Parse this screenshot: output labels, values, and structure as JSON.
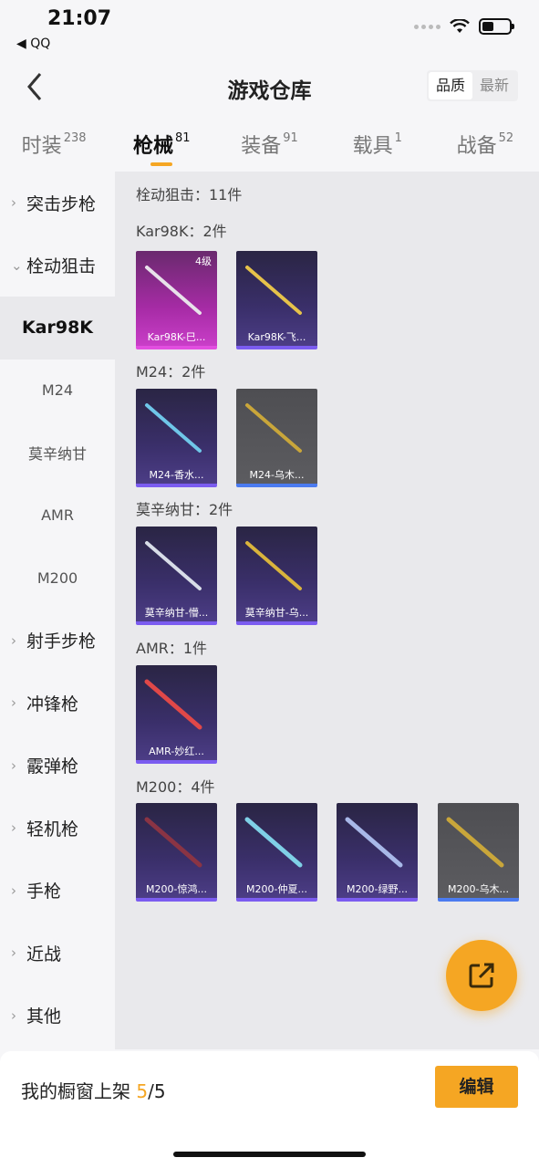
{
  "status": {
    "time": "21:07",
    "back_app": "◀ QQ"
  },
  "header": {
    "title": "游戏仓库",
    "sort_options": [
      "品质",
      "最新"
    ],
    "sort_active": "品质"
  },
  "tabs": [
    {
      "label": "时装",
      "count": "238"
    },
    {
      "label": "枪械",
      "count": "81"
    },
    {
      "label": "装备",
      "count": "91"
    },
    {
      "label": "载具",
      "count": "1"
    },
    {
      "label": "战备",
      "count": "52"
    }
  ],
  "sidebar": [
    {
      "label": "突击步枪",
      "kind": "cat"
    },
    {
      "label": "栓动狙击",
      "kind": "cat-open"
    },
    {
      "label": "Kar98K",
      "kind": "sub-active"
    },
    {
      "label": "M24",
      "kind": "sub"
    },
    {
      "label": "莫辛纳甘",
      "kind": "sub"
    },
    {
      "label": "AMR",
      "kind": "sub"
    },
    {
      "label": "M200",
      "kind": "sub"
    },
    {
      "label": "射手步枪",
      "kind": "cat"
    },
    {
      "label": "冲锋枪",
      "kind": "cat"
    },
    {
      "label": "霰弹枪",
      "kind": "cat"
    },
    {
      "label": "轻机枪",
      "kind": "cat"
    },
    {
      "label": "手枪",
      "kind": "cat"
    },
    {
      "label": "近战",
      "kind": "cat"
    },
    {
      "label": "其他",
      "kind": "cat"
    }
  ],
  "content": {
    "summary": "栓动狙击：11件",
    "groups": [
      {
        "title": "Kar98K：2件",
        "items": [
          {
            "name": "Kar98K-巳...",
            "rarity": "pink",
            "level": "4级",
            "gun_color": "#e8e2ea"
          },
          {
            "name": "Kar98K-飞...",
            "rarity": "purple",
            "gun_color": "#e6c24a"
          }
        ]
      },
      {
        "title": "M24：2件",
        "items": [
          {
            "name": "M24-香水...",
            "rarity": "purple",
            "gun_color": "#6fc6e8"
          },
          {
            "name": "M24-乌木...",
            "rarity": "gray",
            "gun_color": "#c9a63a"
          }
        ]
      },
      {
        "title": "莫辛纳甘：2件",
        "items": [
          {
            "name": "莫辛纳甘-懵...",
            "rarity": "purple",
            "gun_color": "#d8dde8"
          },
          {
            "name": "莫辛纳甘-乌...",
            "rarity": "purple",
            "gun_color": "#d9b43c"
          }
        ]
      },
      {
        "title": "AMR：1件",
        "items": [
          {
            "name": "AMR-妙红...",
            "rarity": "purple",
            "gun_color": "#e04848"
          }
        ]
      },
      {
        "title": "M200：4件",
        "items": [
          {
            "name": "M200-惊鸿...",
            "rarity": "purple",
            "gun_color": "#8a3444"
          },
          {
            "name": "M200-仲夏...",
            "rarity": "purple",
            "gun_color": "#7fd0e6"
          },
          {
            "name": "M200-绿野...",
            "rarity": "purple",
            "gun_color": "#a8b8e8"
          },
          {
            "name": "M200-乌木...",
            "rarity": "gray",
            "gun_color": "#c9a63a"
          }
        ]
      }
    ]
  },
  "bottom": {
    "showcase_prefix": "我的橱窗上架 ",
    "showcase_count": "5",
    "showcase_total": "/5",
    "edit_label": "编辑"
  },
  "colors": {
    "accent": "#f5a623",
    "purple": "#7b5cf0",
    "pink": "#e24ee0"
  }
}
